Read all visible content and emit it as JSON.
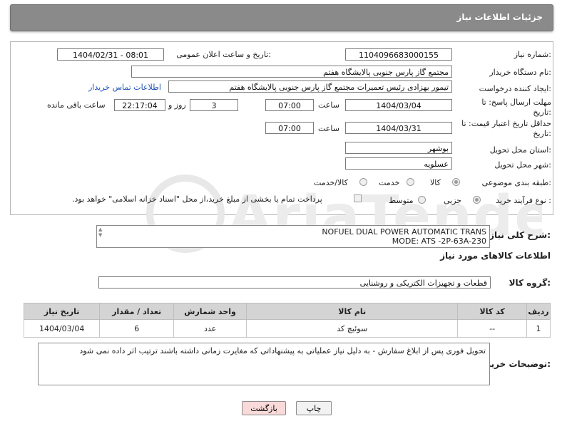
{
  "header": {
    "title": "جزئیات اطلاعات نیاز"
  },
  "form": {
    "need_number_label": "شماره نیاز:",
    "need_number": "1104096683000155",
    "announce_label": "تاریخ و ساعت اعلان عمومی:",
    "announce_value": "1404/02/31 - 08:01",
    "buyer_org_label": "نام دستگاه خریدار:",
    "buyer_org": "مجتمع گاز پارس جنوبی  پالایشگاه هفتم",
    "creator_label": "ایجاد کننده درخواست:",
    "creator": "تیمور بهزادی رئیس تعمیرات مجتمع گاز پارس جنوبی  پالایشگاه هفتم",
    "buyer_contact_link": "اطلاعات تماس خریدار",
    "deadline_label": "مهلت ارسال پاسخ: تا تاریخ:",
    "deadline_date": "1404/03/04",
    "time_label": "ساعت",
    "deadline_time": "07:00",
    "days_value": "3",
    "days_label": "روز و",
    "remaining_time": "22:17:04",
    "remaining_label": "ساعت باقی مانده",
    "validity_label": "حداقل تاریخ اعتبار قیمت: تا تاریخ:",
    "validity_date": "1404/03/31",
    "validity_time": "07:00",
    "province_label": "استان محل تحویل:",
    "province": "بوشهر",
    "city_label": "شهر محل تحویل:",
    "city": "عسلویه",
    "category_label": "طبقه بندی موضوعی:",
    "category_options": [
      "کالا",
      "خدمت",
      "کالا/خدمت"
    ],
    "process_label": "نوع فرآیند خرید :",
    "process_options": [
      "جزیی",
      "متوسط"
    ],
    "payment_note": "پرداخت تمام یا بخشی از مبلغ خرید،از محل \"اسناد خزانه اسلامی\" خواهد بود."
  },
  "summary": {
    "label": "شرح کلی نیاز:",
    "line1": "NOFUEL DUAL POWER  AUTOMATIC TRANS",
    "line2": "MODE: ATS -2P-63A-230"
  },
  "goods_section": {
    "title": "اطلاعات کالاهای مورد نیاز",
    "group_label": "گروه کالا:",
    "group_value": "قطعات و تجهیزات الکتریکی و روشنایی"
  },
  "table": {
    "headers": [
      "ردیف",
      "کد کالا",
      "نام کالا",
      "واحد شمارش",
      "تعداد / مقدار",
      "تاریخ نیاز"
    ],
    "rows": [
      [
        "1",
        "--",
        "سوئیچ کد",
        "عدد",
        "6",
        "1404/03/04"
      ]
    ]
  },
  "buyer_notes": {
    "label": "توضیحات خریدار:",
    "text": "تحویل فوری پس از ابلاغ سفارش - به دلیل نیاز عملیاتی به پیشنهاداتی که مغایرت زمانی داشته باشند ترتیب اثر داده نمی شود"
  },
  "buttons": {
    "print": "چاپ",
    "back": "بازگشت"
  },
  "colors": {
    "header_bg": "#8a8a8a",
    "link": "#2053b5",
    "back_button_bg": "#f9d9d9"
  }
}
